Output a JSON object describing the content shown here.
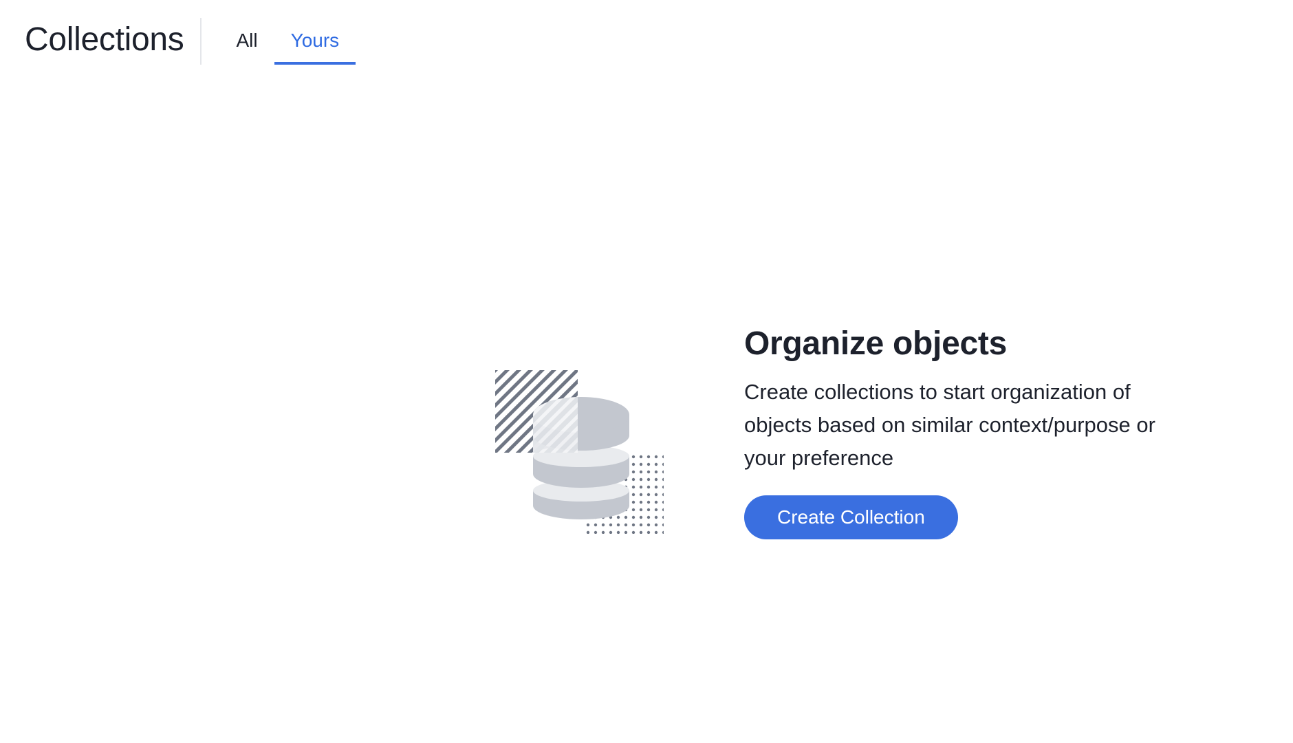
{
  "header": {
    "title": "Collections",
    "tabs": [
      {
        "label": "All",
        "active": false
      },
      {
        "label": "Yours",
        "active": true
      }
    ]
  },
  "empty_state": {
    "illustration_icon": "database-stack-icon",
    "heading": "Organize objects",
    "description": "Create collections to start organization of objects based on similar context/purpose or your preference",
    "button_label": "Create Collection"
  },
  "colors": {
    "accent": "#3a6fe0",
    "text": "#1d212c",
    "illustration_gray": "#c3c7cf",
    "pattern_gray": "#6f7684"
  }
}
